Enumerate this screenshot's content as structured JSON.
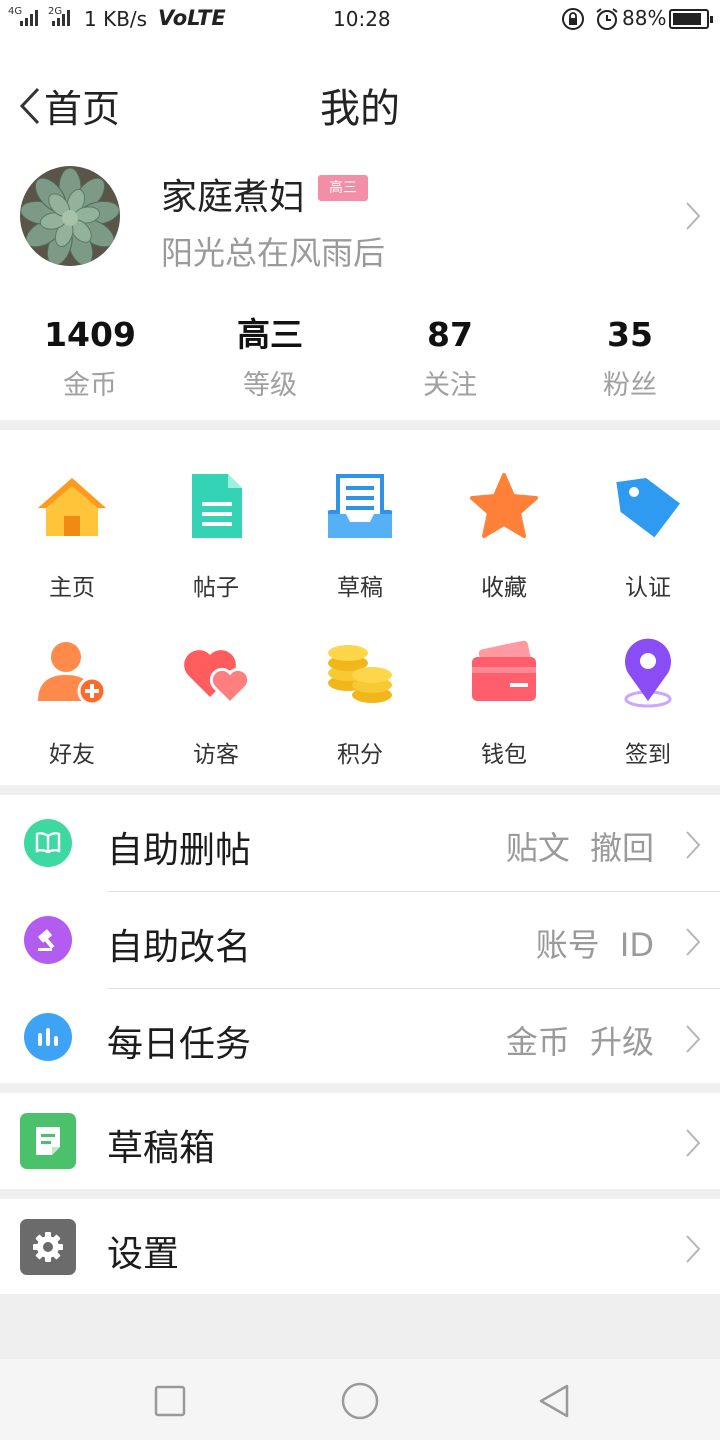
{
  "status_bar": {
    "sim1": "4G",
    "sim2": "2G",
    "speed": "1 KB/s",
    "volte": "VoLTE",
    "time": "10:28",
    "battery": "88%",
    "battery_level": 0.88
  },
  "header": {
    "back_label": "首页",
    "title": "我的"
  },
  "profile": {
    "username": "家庭煮妇",
    "level_badge": "高三",
    "signature": "阳光总在风雨后"
  },
  "stats": [
    {
      "value": "1409",
      "label": "金币"
    },
    {
      "value": "高三",
      "label": "等级"
    },
    {
      "value": "87",
      "label": "关注"
    },
    {
      "value": "35",
      "label": "粉丝"
    }
  ],
  "grid": [
    {
      "label": "主页",
      "icon": "home-icon"
    },
    {
      "label": "帖子",
      "icon": "post-document-icon"
    },
    {
      "label": "草稿",
      "icon": "draft-tray-icon"
    },
    {
      "label": "收藏",
      "icon": "star-icon"
    },
    {
      "label": "认证",
      "icon": "tag-icon"
    },
    {
      "label": "好友",
      "icon": "add-friend-icon"
    },
    {
      "label": "访客",
      "icon": "hearts-icon"
    },
    {
      "label": "积分",
      "icon": "coins-icon"
    },
    {
      "label": "钱包",
      "icon": "wallet-icon"
    },
    {
      "label": "签到",
      "icon": "location-pin-icon"
    }
  ],
  "list": [
    {
      "title": "自助删帖",
      "hint": "贴文 撤回",
      "icon": "book-icon",
      "color": "#3ed9a0"
    },
    {
      "title": "自助改名",
      "hint": "账号 ID",
      "icon": "gavel-icon",
      "color": "#b25cf0"
    },
    {
      "title": "每日任务",
      "hint": "金币 升级",
      "icon": "bar-chart-icon",
      "color": "#3ea2f5"
    }
  ],
  "drafts": {
    "title": "草稿箱",
    "icon": "note-icon",
    "color": "#4cc16c"
  },
  "settings": {
    "title": "设置",
    "icon": "gear-icon",
    "color": "#6b6b6b"
  },
  "colors": {
    "badge": "#f28fa6",
    "muted_text": "#9a9a9a",
    "page_bg": "#efefef"
  }
}
